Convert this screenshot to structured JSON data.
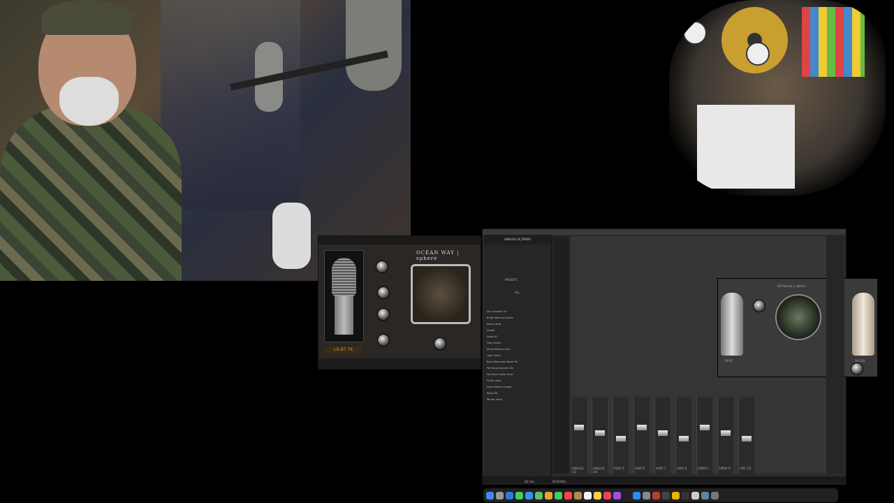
{
  "plugin": {
    "logo": "OCEAN WAY | sphere",
    "mic_model": "LD-87 TK"
  },
  "console": {
    "plugin_title": "Bill Putnam | sphere",
    "left_mic": "SP-87",
    "right_mic": "SP-12A",
    "browser_title": "ANALOG 04_MIXER",
    "browser_tabs": [
      "PRESETS",
      "ALL"
    ],
    "presets": [
      "Dry Acoustic Gtr",
      "Bright Backing Vocals",
      "Room Vocal",
      "Airball",
      "Dylan 67",
      "Fatty Snare",
      "Jamie Mixture Core",
      "Lean Snare",
      "Bass Warmness Boost Kit",
      "Pat Vocal Acoustic Gtr",
      "Pet Voice Guitar Amp",
      "Pretty Vocal",
      "Piano Mixture Upper",
      "Room Kit",
      "Winter Vocal"
    ],
    "channel_labels": [
      "ANALOG 1/2",
      "ANALOG 3/4",
      "ADAT 5",
      "ADAT 6",
      "ADAT 7",
      "ADAT 8",
      "S/PDIF L",
      "S/PDIF R",
      "VIRT 1/2"
    ],
    "status_items": [
      "INTERNAL",
      "48 kHz"
    ]
  },
  "dock": {
    "icons": [
      "finder-icon",
      "launchpad-icon",
      "safari-icon",
      "messages-icon",
      "mail-icon",
      "maps-icon",
      "photos-icon",
      "facetime-icon",
      "calendar-icon",
      "contacts-icon",
      "reminders-icon",
      "notes-icon",
      "music-icon",
      "podcasts-icon",
      "tv-icon",
      "appstore-icon",
      "settings-icon",
      "console-icon",
      "daw-icon",
      "chrome-icon",
      "terminal-icon",
      "text-icon",
      "preview-icon",
      "trash-icon"
    ],
    "colors": [
      "#3b8cf0",
      "#999",
      "#2c7cd6",
      "#3fcf58",
      "#3a8ef5",
      "#5fbf6a",
      "#f0a030",
      "#3ccf5c",
      "#f44",
      "#b88a55",
      "#f5f5f5",
      "#f3d24b",
      "#f04060",
      "#a050e0",
      "#222",
      "#2a8cf0",
      "#888",
      "#c0392b",
      "#444",
      "#eab300",
      "#333",
      "#ccc",
      "#58a",
      "#777"
    ]
  }
}
